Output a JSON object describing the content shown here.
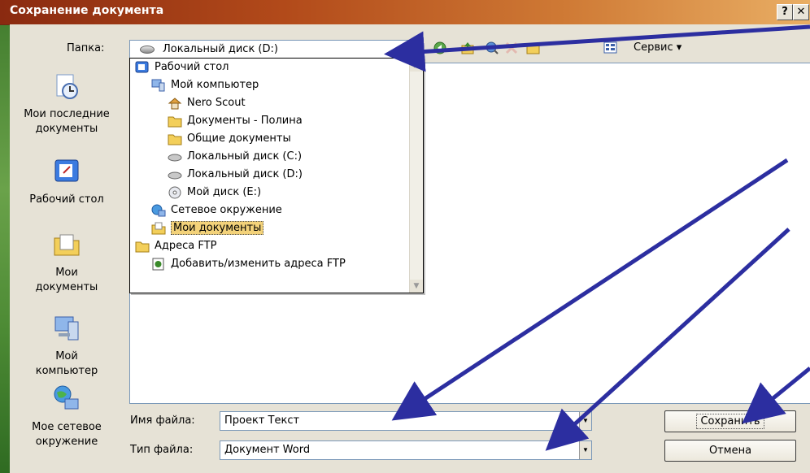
{
  "window": {
    "title": "Сохранение документа",
    "help_label": "?",
    "close_label": "✕"
  },
  "folder": {
    "label": "Папка:",
    "value": "Локальный диск (D:)"
  },
  "toolbar": {
    "service_label": "Сервис ▾"
  },
  "places": [
    {
      "label_line1": "Мои последние",
      "label_line2": "документы",
      "icon": "recent-documents-icon"
    },
    {
      "label_line1": "Рабочий стол",
      "label_line2": "",
      "icon": "desktop-icon"
    },
    {
      "label_line1": "Мои",
      "label_line2": "документы",
      "icon": "my-documents-icon"
    },
    {
      "label_line1": "Мой",
      "label_line2": "компьютер",
      "icon": "my-computer-icon"
    },
    {
      "label_line1": "Мое сетевое",
      "label_line2": "окружение",
      "icon": "network-icon"
    }
  ],
  "dropdown": {
    "items": [
      {
        "label": "Рабочий стол",
        "icon": "desktop-icon"
      },
      {
        "label": "Мой компьютер",
        "icon": "computer-icon"
      },
      {
        "label": "Nero Scout",
        "icon": "nero-scout-icon"
      },
      {
        "label": "Документы - Полина",
        "icon": "folder-icon"
      },
      {
        "label": "Общие документы",
        "icon": "folder-icon"
      },
      {
        "label": "Локальный диск (C:)",
        "icon": "disk-icon"
      },
      {
        "label": "Локальный диск (D:)",
        "icon": "disk-icon"
      },
      {
        "label": "Мой диск (E:)",
        "icon": "cd-drive-icon"
      },
      {
        "label": "Сетевое окружение",
        "icon": "network-icon"
      },
      {
        "label": "Мои документы",
        "icon": "my-documents-icon"
      },
      {
        "label": "Адреса FTP",
        "icon": "folder-icon"
      },
      {
        "label": "Добавить/изменить адреса FTP",
        "icon": "ftp-edit-icon"
      }
    ],
    "selected_index": 9
  },
  "file_name": {
    "label": "Имя файла:",
    "value": "Проект Текст"
  },
  "file_type": {
    "label": "Тип файла:",
    "value": "Документ Word"
  },
  "buttons": {
    "save": "Сохранить",
    "cancel": "Отмена"
  },
  "colors": {
    "title_gradient_start": "#8a2a10",
    "title_gradient_end": "#e9ae64",
    "dialog_bg": "#e6e2d6",
    "arrow": "#2c2ea0",
    "selected_item": "#f3d27a"
  }
}
